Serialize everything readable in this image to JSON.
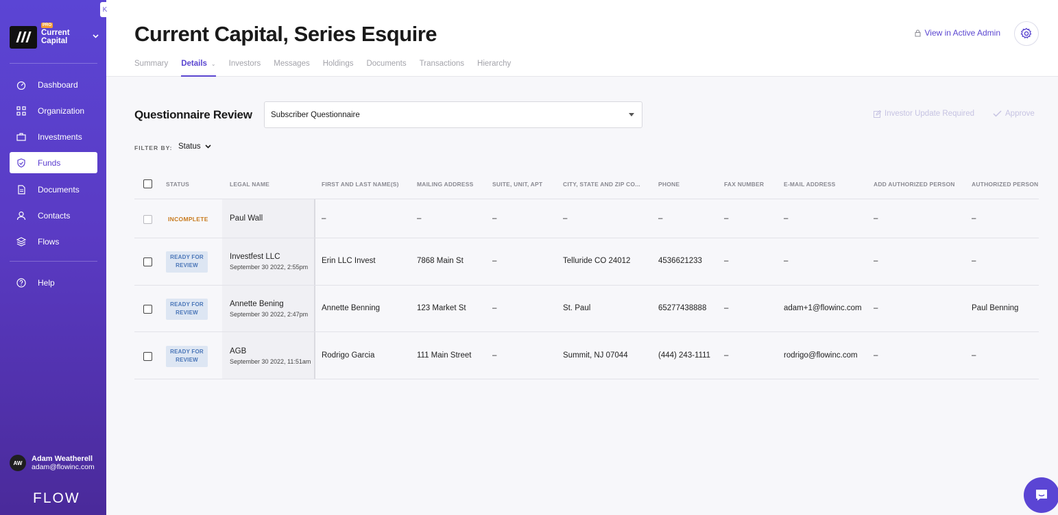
{
  "sidebar": {
    "collapse_label": "K",
    "org": {
      "badge": "PRO",
      "name": "Current Capital"
    },
    "nav": [
      {
        "label": "Dashboard",
        "icon": "dashboard-icon"
      },
      {
        "label": "Organization",
        "icon": "organization-icon"
      },
      {
        "label": "Investments",
        "icon": "briefcase-icon"
      },
      {
        "label": "Funds",
        "icon": "shield-check-icon",
        "active": true
      },
      {
        "label": "Documents",
        "icon": "document-icon"
      },
      {
        "label": "Contacts",
        "icon": "person-icon"
      },
      {
        "label": "Flows",
        "icon": "layers-icon"
      }
    ],
    "help_label": "Help",
    "user": {
      "initials": "AW",
      "name": "Adam Weatherell",
      "email": "adam@flowinc.com"
    },
    "brand": "FLOW"
  },
  "header": {
    "title": "Current Capital, Series Esquire",
    "admin_link": "View in Active Admin",
    "tabs": [
      "Summary",
      "Details",
      "Investors",
      "Messages",
      "Holdings",
      "Documents",
      "Transactions",
      "Hierarchy"
    ],
    "active_tab": "Details"
  },
  "main": {
    "section_title": "Questionnaire Review",
    "questionnaire_select": "Subscriber Questionnaire",
    "investor_update_btn": "Investor Update Required",
    "approve_btn": "Approve",
    "filter_label": "FILTER BY:",
    "filter_value": "Status"
  },
  "table": {
    "columns": [
      "STATUS",
      "LEGAL NAME",
      "FIRST AND LAST NAME(S)",
      "MAILING ADDRESS",
      "SUITE, UNIT, APT",
      "CITY, STATE AND ZIP CO...",
      "PHONE",
      "FAX NUMBER",
      "E-MAIL ADDRESS",
      "ADD AUTHORIZED PERSON",
      "AUTHORIZED PERSON N"
    ],
    "rows": [
      {
        "status": "INCOMPLETE",
        "legal_name": "Paul Wall",
        "date": "",
        "name": "–",
        "address": "–",
        "suite": "–",
        "city": "–",
        "phone": "–",
        "fax": "–",
        "email": "–",
        "add_auth": "–",
        "auth_name": "–"
      },
      {
        "status": "READY FOR REVIEW",
        "legal_name": "Investfest LLC",
        "date": "September 30 2022, 2:55pm",
        "name": "Erin LLC Invest",
        "address": "7868 Main St",
        "suite": "–",
        "city": "Telluride CO 24012",
        "phone": "4536621233",
        "fax": "–",
        "email": "–",
        "add_auth": "–",
        "auth_name": "–"
      },
      {
        "status": "READY FOR REVIEW",
        "legal_name": "Annette Bening",
        "date": "September 30 2022, 2:47pm",
        "name": "Annette Benning",
        "address": "123 Market St",
        "suite": "–",
        "city": "St. Paul",
        "phone": "65277438888",
        "fax": "–",
        "email": "adam+1@flowinc.com",
        "add_auth": "–",
        "auth_name": "Paul Benning"
      },
      {
        "status": "READY FOR REVIEW",
        "legal_name": "AGB",
        "date": "September 30 2022, 11:51am",
        "name": "Rodrigo Garcia",
        "address": "111 Main Street",
        "suite": "–",
        "city": "Summit, NJ 07044",
        "phone": "(444) 243-1111",
        "fax": "–",
        "email": "rodrigo@flowinc.com",
        "add_auth": "–",
        "auth_name": "–"
      }
    ]
  },
  "colors": {
    "primary": "#5a45d0",
    "incomplete": "#c87a1d",
    "ready_bg": "#dde6f3",
    "ready_text": "#4a76b8"
  }
}
